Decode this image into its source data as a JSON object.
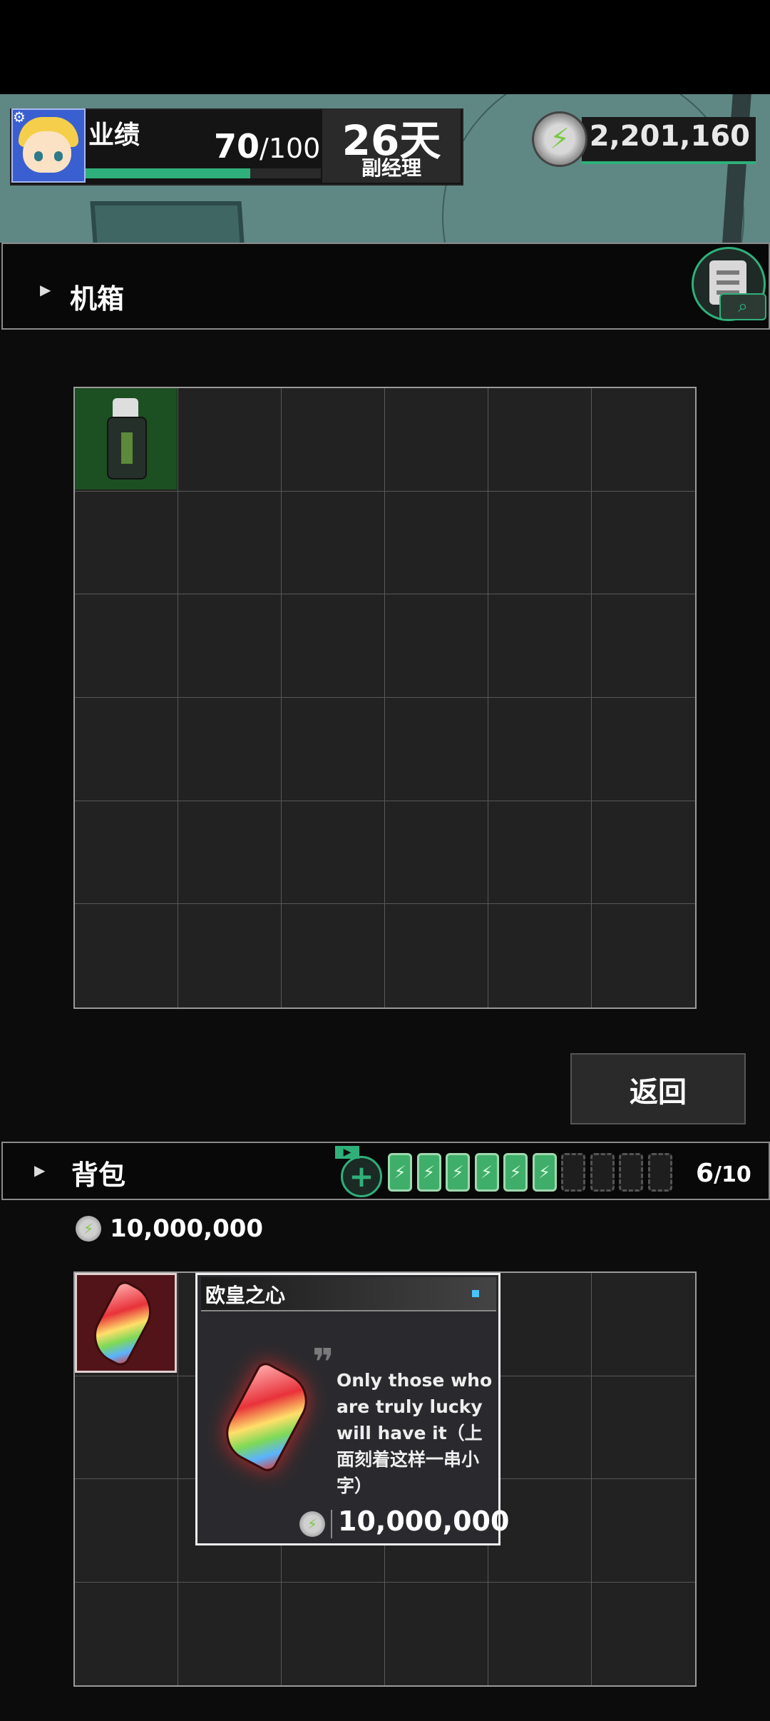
{
  "header": {
    "performance_label": "业绩",
    "performance_value": "70",
    "performance_max": "/100",
    "performance_fraction": 0.7,
    "days": "26天",
    "rank": "副经理",
    "coin_total": "2,201,160"
  },
  "machine": {
    "title": "机箱",
    "grid_columns": 6,
    "grid_rows": 6,
    "items": [
      {
        "slot": 0,
        "icon": "bottle-icon"
      }
    ]
  },
  "return_button": {
    "label": "返回"
  },
  "bag": {
    "title": "背包",
    "ad_tag": "▶",
    "add_symbol": "+",
    "battery_symbol": "⚡",
    "batteries_filled": 6,
    "batteries_total": 10,
    "capacity_current": "6",
    "capacity_max": "/10",
    "money": "10,000,000",
    "grid_columns": 6,
    "grid_rows": 4,
    "items": [
      {
        "slot": 0,
        "icon": "red-gem-icon"
      }
    ]
  },
  "tooltip": {
    "quote": "❞",
    "name": "欧皇之心",
    "description": "Only those who are truly lucky will have it（上面刻着这样一串小字）",
    "price": "10,000,000"
  },
  "icons": {
    "coin_symbol": "⚡",
    "gear_symbol": "⚙"
  },
  "colors": {
    "accent": "#2fb07a",
    "background": "#0c0c0c",
    "header": "#5f8885",
    "gem_slot": "#521418",
    "bottle_slot": "#1c4f22"
  }
}
